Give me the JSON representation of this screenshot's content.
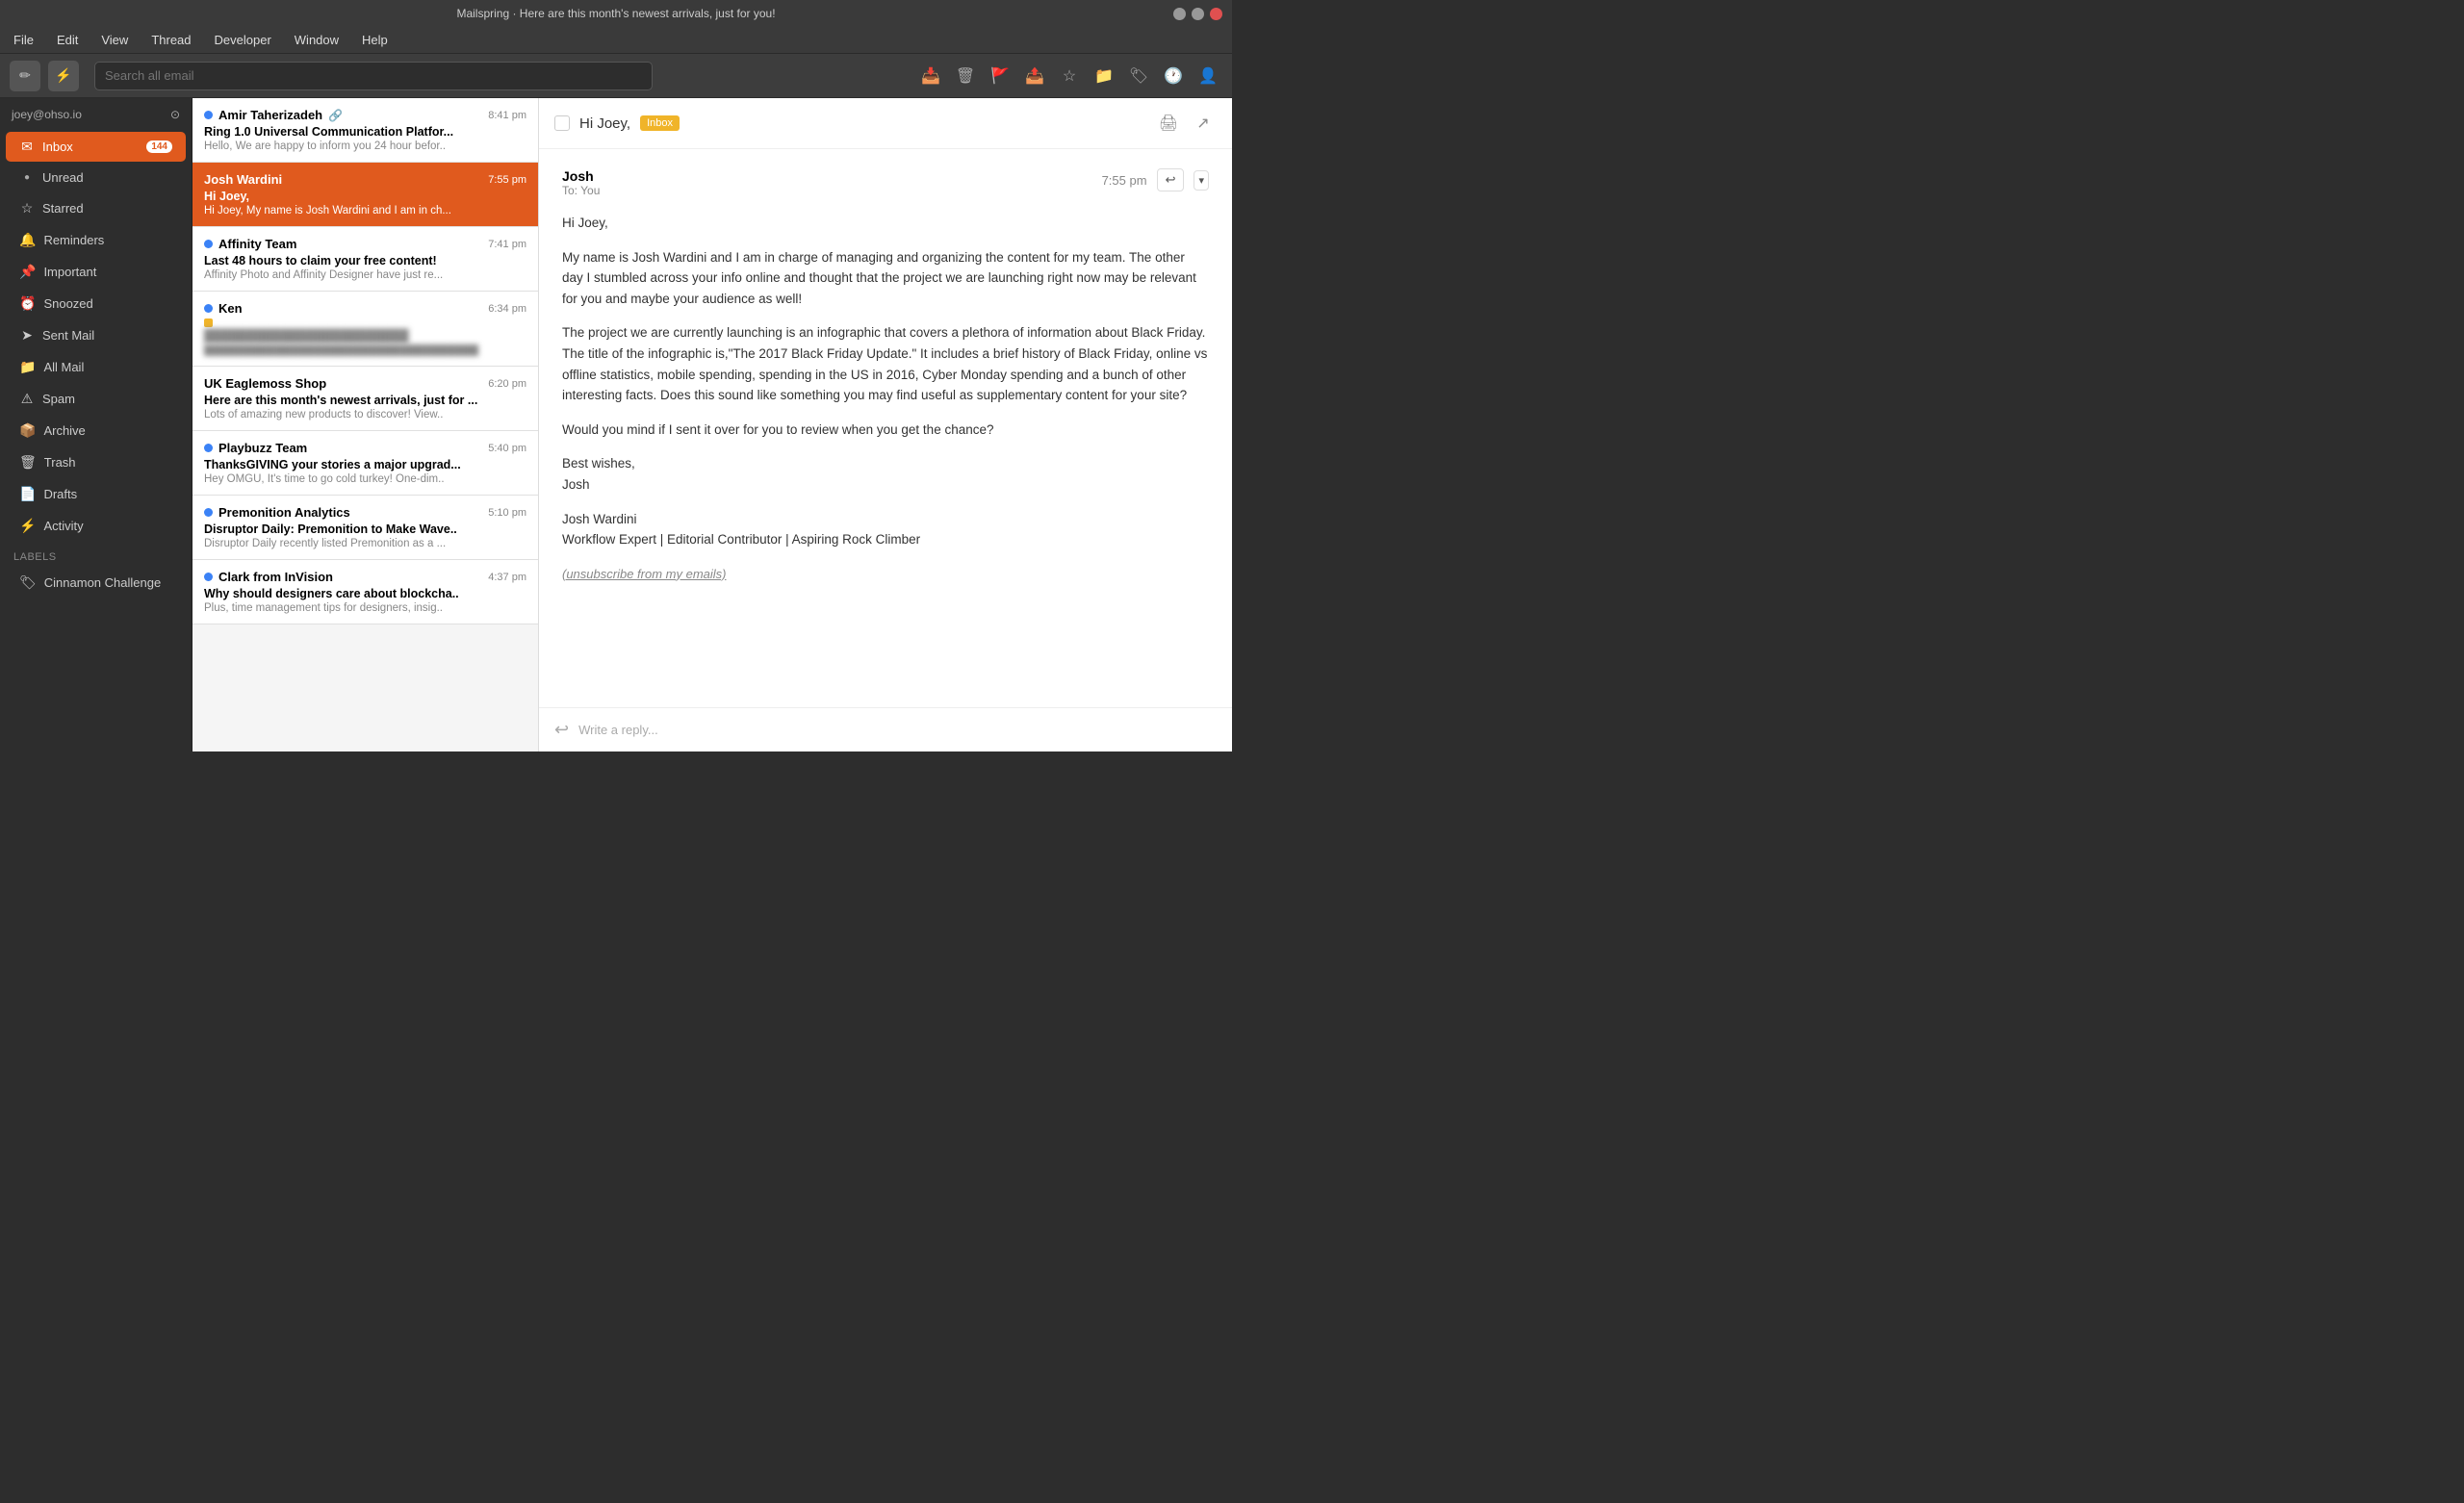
{
  "window": {
    "title": "Mailspring · Here are this month's newest arrivals, just for you!"
  },
  "menubar": {
    "items": [
      "File",
      "Edit",
      "View",
      "Thread",
      "Developer",
      "Window",
      "Help"
    ]
  },
  "toolbar": {
    "search_placeholder": "Search all email",
    "compose_icon": "✏",
    "lightning_icon": "⚡",
    "archive_icon": "📥",
    "trash_icon": "🗑",
    "report_icon": "🚩",
    "send_icon": "📤",
    "star_icon": "☆",
    "folder_icon": "📁",
    "tag_icon": "🏷",
    "clock_icon": "🕐",
    "person_icon": "👤"
  },
  "sidebar": {
    "account": "joey@ohso.io",
    "nav_items": [
      {
        "id": "inbox",
        "label": "Inbox",
        "icon": "✉",
        "badge": "144",
        "active": true
      },
      {
        "id": "unread",
        "label": "Unread",
        "icon": "●"
      },
      {
        "id": "starred",
        "label": "Starred",
        "icon": "☆"
      },
      {
        "id": "reminders",
        "label": "Reminders",
        "icon": "🔔"
      },
      {
        "id": "important",
        "label": "Important",
        "icon": "📌"
      },
      {
        "id": "snoozed",
        "label": "Snoozed",
        "icon": "⏰"
      },
      {
        "id": "sent",
        "label": "Sent Mail",
        "icon": "➤"
      },
      {
        "id": "all",
        "label": "All Mail",
        "icon": "📁"
      },
      {
        "id": "spam",
        "label": "Spam",
        "icon": "⚠"
      },
      {
        "id": "archive",
        "label": "Archive",
        "icon": "📦"
      },
      {
        "id": "trash",
        "label": "Trash",
        "icon": "🗑"
      },
      {
        "id": "drafts",
        "label": "Drafts",
        "icon": "📄"
      },
      {
        "id": "activity",
        "label": "Activity",
        "icon": "⚡"
      }
    ],
    "labels_section": "Labels",
    "labels": [
      {
        "id": "cinnamon",
        "label": "Cinnamon Challenge",
        "icon": "🏷"
      }
    ]
  },
  "email_list": {
    "emails": [
      {
        "id": 1,
        "sender": "Amir Taherizadeh",
        "time": "8:41 pm",
        "subject": "Ring 1.0 Universal Communication Platfor...",
        "preview": "Hello, We are happy to inform you 24 hour befor..",
        "unread": true,
        "selected": false,
        "has_link": true
      },
      {
        "id": 2,
        "sender": "Josh Wardini",
        "time": "7:55 pm",
        "subject": "Hi Joey,",
        "preview": "Hi Joey, My name is Josh Wardini and I am in ch...",
        "unread": false,
        "selected": true
      },
      {
        "id": 3,
        "sender": "Affinity Team",
        "time": "7:41 pm",
        "subject": "Last 48 hours to claim your free content!",
        "preview": "Affinity Photo and Affinity Designer have just re...",
        "unread": true,
        "selected": false
      },
      {
        "id": 4,
        "sender": "Ken",
        "time": "6:34 pm",
        "subject": "████████████████████████",
        "preview": "██████████████████████████████████",
        "unread": true,
        "selected": false,
        "blurred": true,
        "yellow_square": true
      },
      {
        "id": 5,
        "sender": "UK Eaglemoss Shop",
        "time": "6:20 pm",
        "subject": "Here are this month's newest arrivals, just for ...",
        "preview": "Lots of amazing new products to discover! View..",
        "unread": false,
        "selected": false
      },
      {
        "id": 6,
        "sender": "Playbuzz Team",
        "time": "5:40 pm",
        "subject": "ThanksGIVING your stories a major upgrad...",
        "preview": "Hey OMGU, It's time to go cold turkey! One-dim..",
        "unread": true,
        "selected": false
      },
      {
        "id": 7,
        "sender": "Premonition Analytics",
        "time": "5:10 pm",
        "subject": "Disruptor Daily: Premonition to Make Wave..",
        "preview": "Disruptor Daily recently listed Premonition as a ...",
        "unread": true,
        "selected": false
      },
      {
        "id": 8,
        "sender": "Clark from InVision",
        "time": "4:37 pm",
        "subject": "Why should designers care about blockcha..",
        "preview": "Plus, time management tips for designers, insig..",
        "unread": true,
        "selected": false
      }
    ]
  },
  "email_detail": {
    "subject": "Hi Joey,",
    "label": "Inbox",
    "from_name": "Josh",
    "to": "To: You",
    "time": "7:55 pm",
    "body_paragraphs": [
      "Hi Joey,",
      "My name is Josh Wardini and I am in charge of managing and organizing the content for my team. The other day I stumbled across your info online and thought that the project we are launching right now may be relevant for you and maybe your audience as well!",
      "The project we are currently launching is an infographic that covers a plethora of information about Black Friday. The title of the infographic is,\"The 2017 Black Friday Update.\" It includes a brief history of Black Friday, online vs offline statistics, mobile spending, spending in the US in 2016, Cyber Monday spending and a bunch of other interesting facts. Does this sound like something you may find useful as supplementary content for your site?",
      "Would you mind if I sent it over for you to review when you get the chance?",
      "Best wishes,\nJosh",
      "Josh Wardini\nWorkflow Expert | Editorial Contributor | Aspiring Rock Climber"
    ],
    "unsubscribe_text": "(unsubscribe from my emails)",
    "reply_placeholder": "Write a reply..."
  }
}
